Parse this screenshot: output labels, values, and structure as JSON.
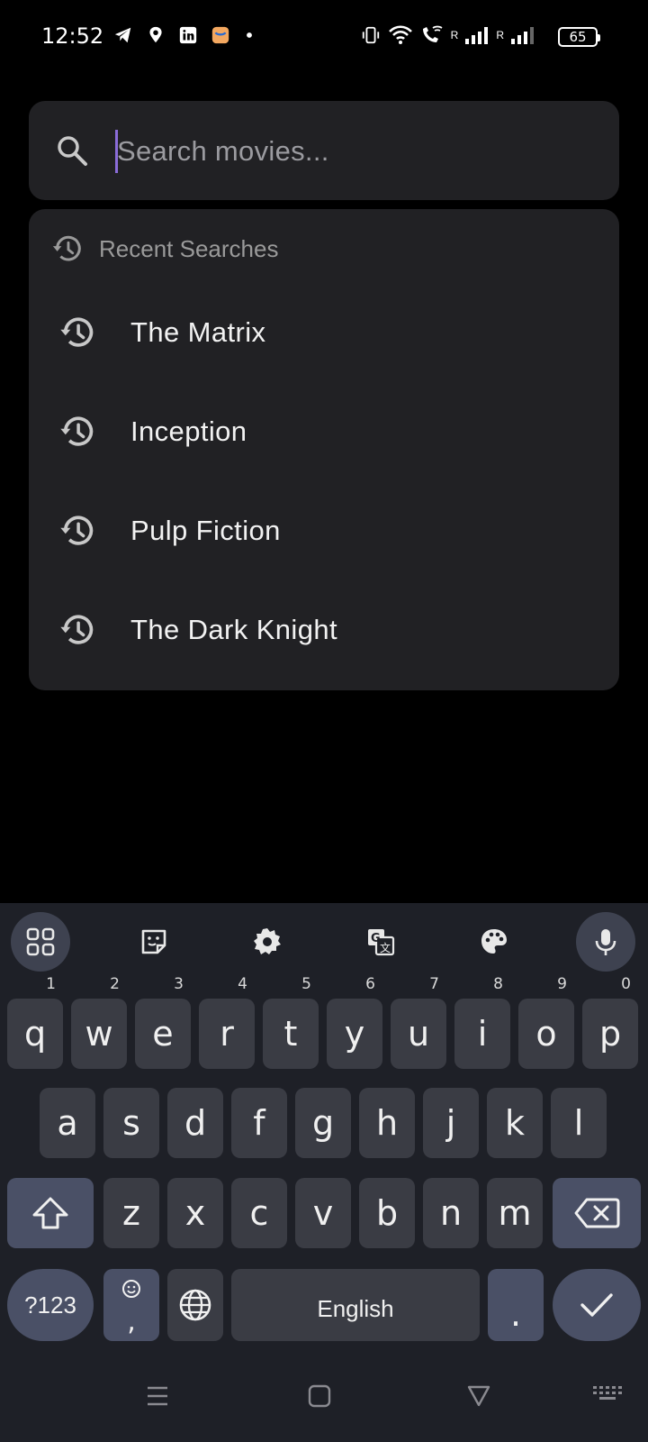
{
  "status_bar": {
    "time": "12:52",
    "signal_label_1": "R",
    "signal_label_2": "R",
    "battery": "65"
  },
  "search": {
    "placeholder": "Search movies...",
    "value": ""
  },
  "recent": {
    "title": "Recent Searches",
    "items": [
      {
        "label": "The Matrix"
      },
      {
        "label": "Inception"
      },
      {
        "label": "Pulp Fiction"
      },
      {
        "label": "The Dark Knight"
      }
    ]
  },
  "keyboard": {
    "row1": [
      {
        "key": "q",
        "hint": "1"
      },
      {
        "key": "w",
        "hint": "2"
      },
      {
        "key": "e",
        "hint": "3"
      },
      {
        "key": "r",
        "hint": "4"
      },
      {
        "key": "t",
        "hint": "5"
      },
      {
        "key": "y",
        "hint": "6"
      },
      {
        "key": "u",
        "hint": "7"
      },
      {
        "key": "i",
        "hint": "8"
      },
      {
        "key": "o",
        "hint": "9"
      },
      {
        "key": "p",
        "hint": "0"
      }
    ],
    "row2": [
      "a",
      "s",
      "d",
      "f",
      "g",
      "h",
      "j",
      "k",
      "l"
    ],
    "row3": [
      "z",
      "x",
      "c",
      "v",
      "b",
      "n",
      "m"
    ],
    "symbols_label": "?123",
    "emoji_comma": ",",
    "space_label": "English",
    "period": "."
  },
  "colors": {
    "background": "#000000",
    "card": "#212124",
    "caret": "#8a6cd8",
    "keyboard_bg": "#1e2027",
    "key_bg": "#3a3c44",
    "action_key_bg": "#4a5066"
  }
}
